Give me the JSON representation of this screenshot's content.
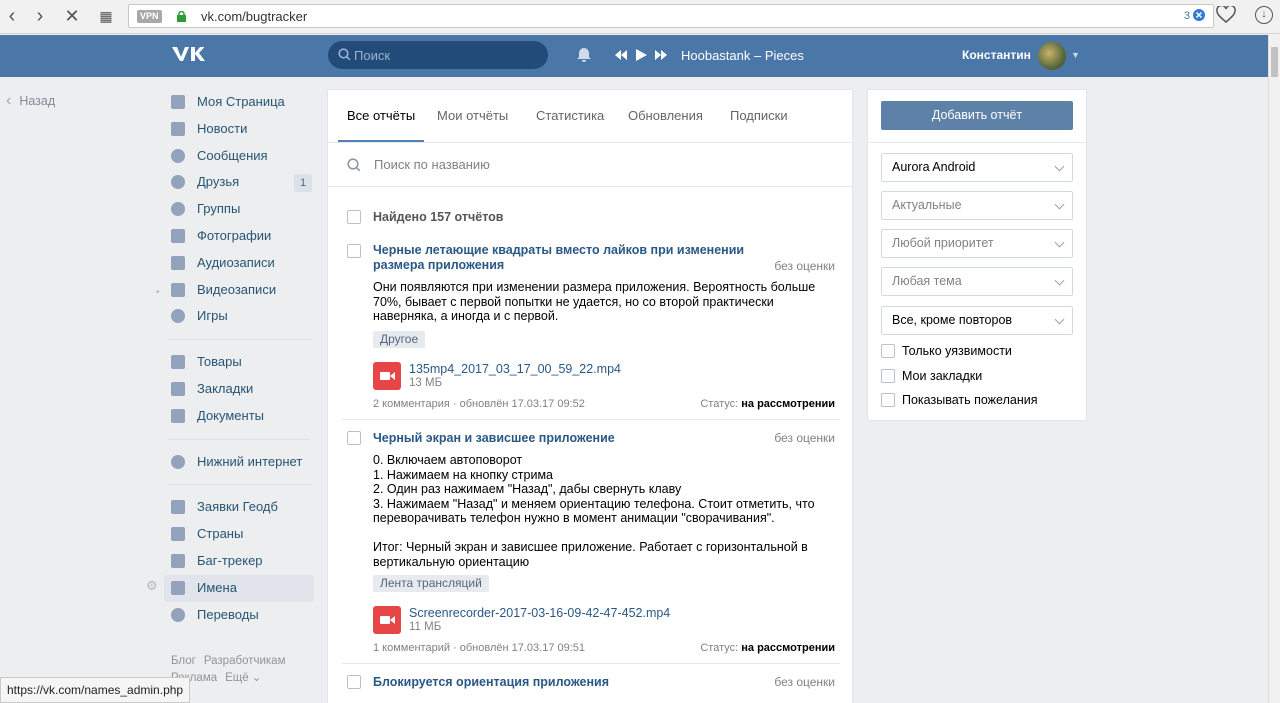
{
  "browser": {
    "vpn_label": "VPN",
    "url": "vk.com/bugtracker",
    "badge_count": "3",
    "status_url": "https://vk.com/names_admin.php"
  },
  "header": {
    "search_placeholder": "Поиск",
    "track": "Hoobastank – Pieces",
    "user_name": "Константин"
  },
  "back_label": "Назад",
  "nav": {
    "items": [
      {
        "label": "Моя Страница"
      },
      {
        "label": "Новости"
      },
      {
        "label": "Сообщения"
      },
      {
        "label": "Друзья",
        "count": "1"
      },
      {
        "label": "Группы"
      },
      {
        "label": "Фотографии"
      },
      {
        "label": "Аудиозаписи"
      },
      {
        "label": "Видеозаписи"
      },
      {
        "label": "Игры"
      },
      {
        "label": "Товары"
      },
      {
        "label": "Закладки"
      },
      {
        "label": "Документы"
      },
      {
        "label": "Нижний интернет"
      },
      {
        "label": "Заявки Геодб"
      },
      {
        "label": "Страны"
      },
      {
        "label": "Баг-трекер"
      },
      {
        "label": "Имена"
      },
      {
        "label": "Переводы"
      }
    ],
    "footer": [
      "Блог",
      "Разработчикам",
      "Реклама",
      "Ещё ⌄"
    ]
  },
  "main": {
    "tabs": [
      "Все отчёты",
      "Мои отчёты",
      "Статистика",
      "Обновления",
      "Подписки"
    ],
    "search_placeholder": "Поиск по названию",
    "found_text": "Найдено 157 отчётов",
    "reports": [
      {
        "title": "Черные летающие квадраты вместо лайков при изменении размера приложения",
        "rating": "без оценки",
        "body": "Они появляются при изменении размера приложения. Вероятность больше 70%, бывает с первой попытки не удается, но со второй практически наверняка, а иногда и с первой.",
        "tag": "Другое",
        "file_name": "135mp4_2017_03_17_00_59_22.mp4",
        "file_size": "13 МБ",
        "comments": "2 комментария",
        "updated": "обновлён 17.03.17 09:52",
        "status_label": "Статус:",
        "status_value": "на рассмотрении"
      },
      {
        "title": "Черный экран и зависшее приложение",
        "rating": "без оценки",
        "body": "0. Включаем автоповорот\n1. Нажимаем на кнопку стрима\n2. Один раз нажимаем \"Назад\", дабы свернуть клаву\n3. Нажимаем \"Назад\" и меняем ориентацию телефона. Стоит отметить, что переворачивать телефон нужно в момент анимации \"сворачивания\".\n\nИтог: Черный экран и зависшее приложение. Работает с горизонтальной в вертикальную ориентацию",
        "tag": "Лента трансляций",
        "file_name": "Screenrecorder-2017-03-16-09-42-47-452.mp4",
        "file_size": "11 МБ",
        "comments": "1 комментарий",
        "updated": "обновлён 17.03.17 09:51",
        "status_label": "Статус:",
        "status_value": "на рассмотрении"
      },
      {
        "title": "Блокируется ориентация приложения",
        "rating": "без оценки"
      }
    ]
  },
  "sidebar": {
    "add_button": "Добавить отчёт",
    "dropdowns": [
      {
        "value": "Aurora Android",
        "placeholder": false
      },
      {
        "value": "Актуальные",
        "placeholder": true
      },
      {
        "value": "Любой приоритет",
        "placeholder": true
      },
      {
        "value": "Любая тема",
        "placeholder": true
      },
      {
        "value": "Все, кроме повторов",
        "placeholder": false
      }
    ],
    "checkboxes": [
      "Только уязвимости",
      "Мои закладки",
      "Показывать пожелания"
    ]
  }
}
